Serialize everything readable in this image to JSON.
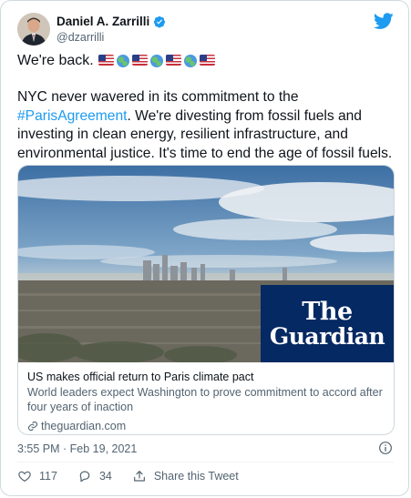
{
  "author": {
    "name": "Daniel A. Zarrilli",
    "handle": "@dzarrilli",
    "verified": true
  },
  "tweet": {
    "line1": "We're back.",
    "emojis": [
      "us-flag",
      "globe",
      "us-flag",
      "globe",
      "us-flag",
      "globe",
      "us-flag"
    ],
    "body_before": "NYC never wavered in its commitment to the ",
    "hashtag": "#ParisAgreement",
    "body_after": ". We're divesting from fossil fuels and investing in clean energy, resilient infrastructure, and environmental justice. It's time to end the age of fossil fuels."
  },
  "link_card": {
    "logo_line1": "The",
    "logo_line2": "Guardian",
    "title": "US makes official return to Paris climate pact",
    "description": "World leaders expect Washington to prove commitment to accord after four years of inaction",
    "domain": "theguardian.com"
  },
  "timestamp": "3:55 PM · Feb 19, 2021",
  "actions": {
    "likes": "117",
    "replies": "34",
    "share_label": "Share this Tweet"
  },
  "colors": {
    "accent": "#1d9bf0",
    "secondary_text": "#536471",
    "guardian_blue": "#052962"
  }
}
